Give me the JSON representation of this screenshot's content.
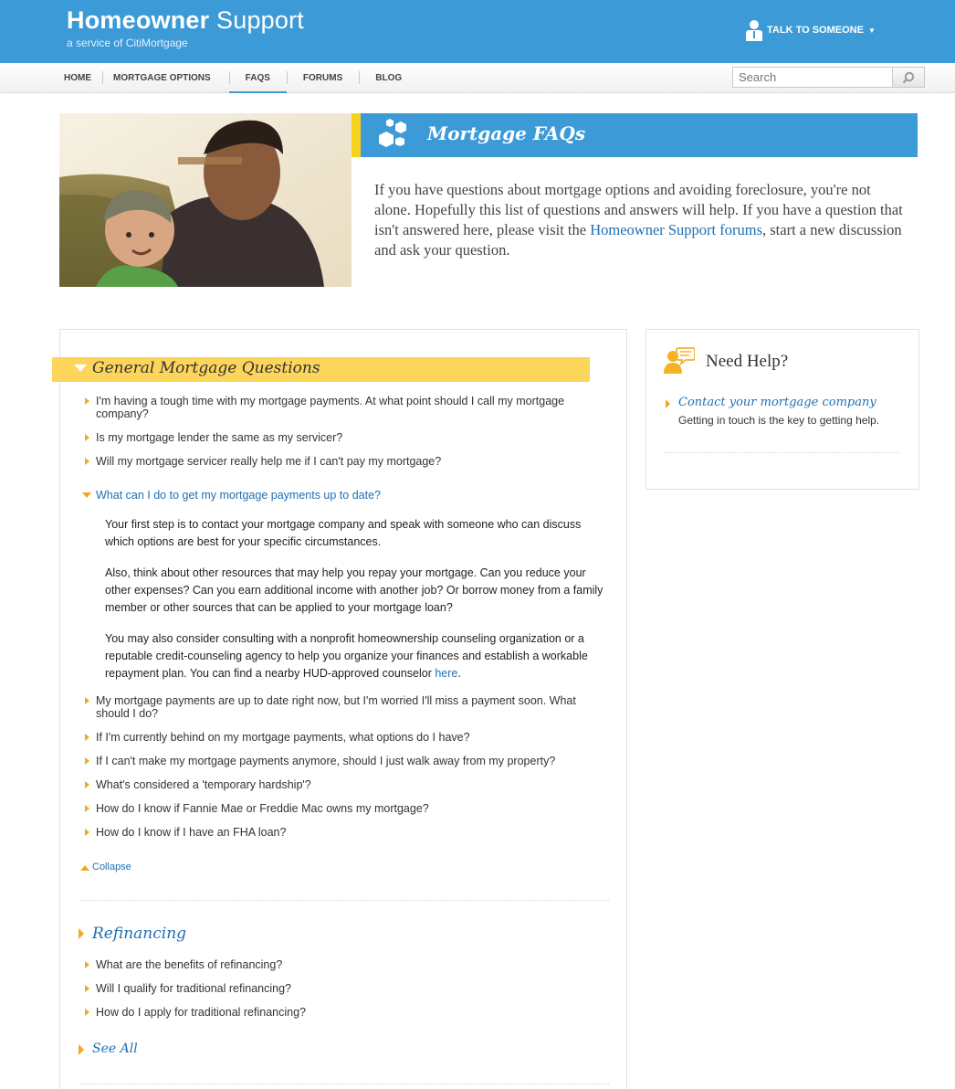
{
  "header": {
    "brand_title_bold": "Homeowner",
    "brand_title_light": "Support",
    "brand_subtitle": "a service of CitiMortgage",
    "talk_label": "TALK TO SOMEONE"
  },
  "nav": {
    "items": [
      "HOME",
      "MORTGAGE OPTIONS",
      "FAQS",
      "FORUMS",
      "BLOG"
    ],
    "active": "FAQS"
  },
  "search": {
    "placeholder": "Search"
  },
  "hero": {
    "banner_title": "Mortgage FAQs",
    "intro_before": "If you have questions about mortgage options and avoiding foreclosure, you're not alone. Hopefully this list of questions and answers will help. If you have a question that isn't answered here, please visit the ",
    "intro_link": "Homeowner Support forums",
    "intro_after": ", start a new discussion and ask your question."
  },
  "general": {
    "title": "General Mortgage Questions",
    "questions": [
      "I'm having a tough time with my mortgage payments. At what point should I call my mortgage company?",
      "Is my mortgage lender the same as my servicer?",
      "Will my mortgage servicer really help me if I can't pay my mortgage?",
      "What can I do to get my mortgage payments up to date?",
      "My mortgage payments are up to date right now, but I'm worried I'll miss a payment soon. What should I do?",
      "If I'm currently behind on my mortgage payments, what options do I have?",
      "If I can't make my mortgage payments anymore, should I just walk away from my property?",
      "What's considered a 'temporary hardship'?",
      "How do I know if Fannie Mae or Freddie Mac owns my mortgage?",
      "How do I know if I have an FHA loan?"
    ],
    "answer": {
      "p1": "Your first step is to contact your mortgage company and speak with someone who can discuss which options are best for your specific circumstances.",
      "p2": "Also, think about other resources that may help you repay your mortgage. Can you reduce your other expenses? Can you earn additional income with another job? Or borrow money from a family member or other sources that can be applied to your mortgage loan?",
      "p3": "You may also consider consulting with a nonprofit homeownership counseling organization or a reputable credit-counseling agency to help you organize your finances and establish a workable repayment plan. You can find a nearby HUD-approved counselor ",
      "p3_link": "here",
      "p3_end": "."
    },
    "collapse_label": "Collapse"
  },
  "refinancing": {
    "title": "Refinancing",
    "questions": [
      "What are the benefits of refinancing?",
      "Will I qualify for traditional refinancing?",
      "How do I apply for traditional refinancing?"
    ],
    "see_all": "See All"
  },
  "sidebar": {
    "title": "Need Help?",
    "link": "Contact your mortgage company",
    "desc": "Getting in touch is the key to getting help."
  }
}
